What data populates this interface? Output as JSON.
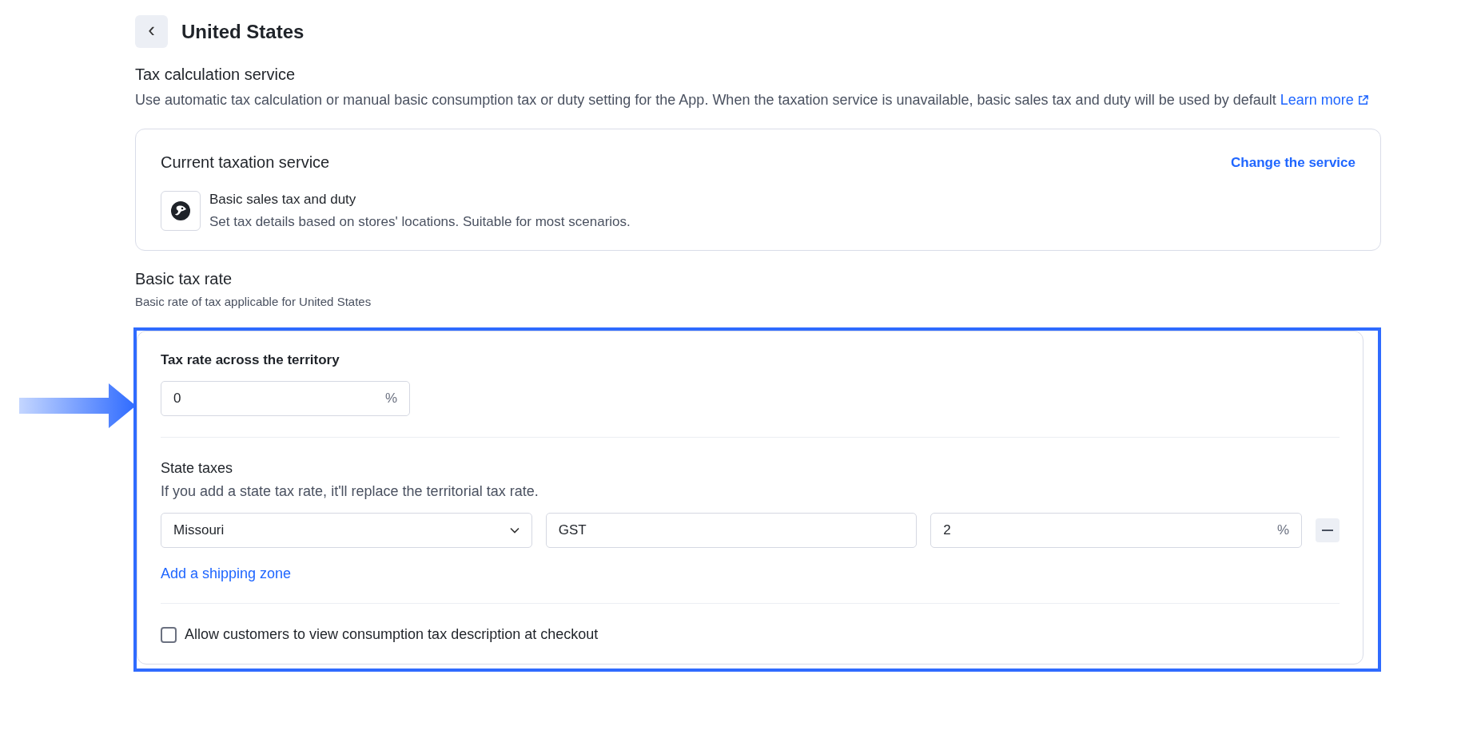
{
  "header": {
    "back_button": "‹",
    "title": "United States"
  },
  "tax_calculation": {
    "title": "Tax calculation service",
    "description": "Use automatic tax calculation or manual basic consumption tax or duty setting for the App. When the taxation service is unavailable, basic sales tax and duty will be used by default",
    "link": "Learn more"
  },
  "current_service": {
    "title": "Current taxation service",
    "action": "Change the service",
    "service_name": "Basic sales tax and duty",
    "service_description": "Set tax details based on stores' locations. Suitable for most scenarios."
  },
  "basic_tax_rate": {
    "title": "Basic tax rate",
    "subtitle": "Basic rate of tax applicable for United States",
    "territory": {
      "label": "Tax rate across the territory",
      "value": "0",
      "suffix": "%"
    },
    "state_taxes": {
      "title": "State taxes",
      "description": "If you add a state tax rate, it'll replace the territorial tax rate.",
      "rows": [
        {
          "fields": [
            {
              "kind": "select",
              "value": "Missouri"
            },
            {
              "kind": "text",
              "value": "GST"
            },
            {
              "kind": "percent",
              "value": "2",
              "suffix": "%"
            }
          ]
        }
      ],
      "add_link": "Add a shipping zone"
    },
    "checkbox": {
      "label": "Allow customers to view consumption tax description at checkout",
      "checked": false
    }
  }
}
